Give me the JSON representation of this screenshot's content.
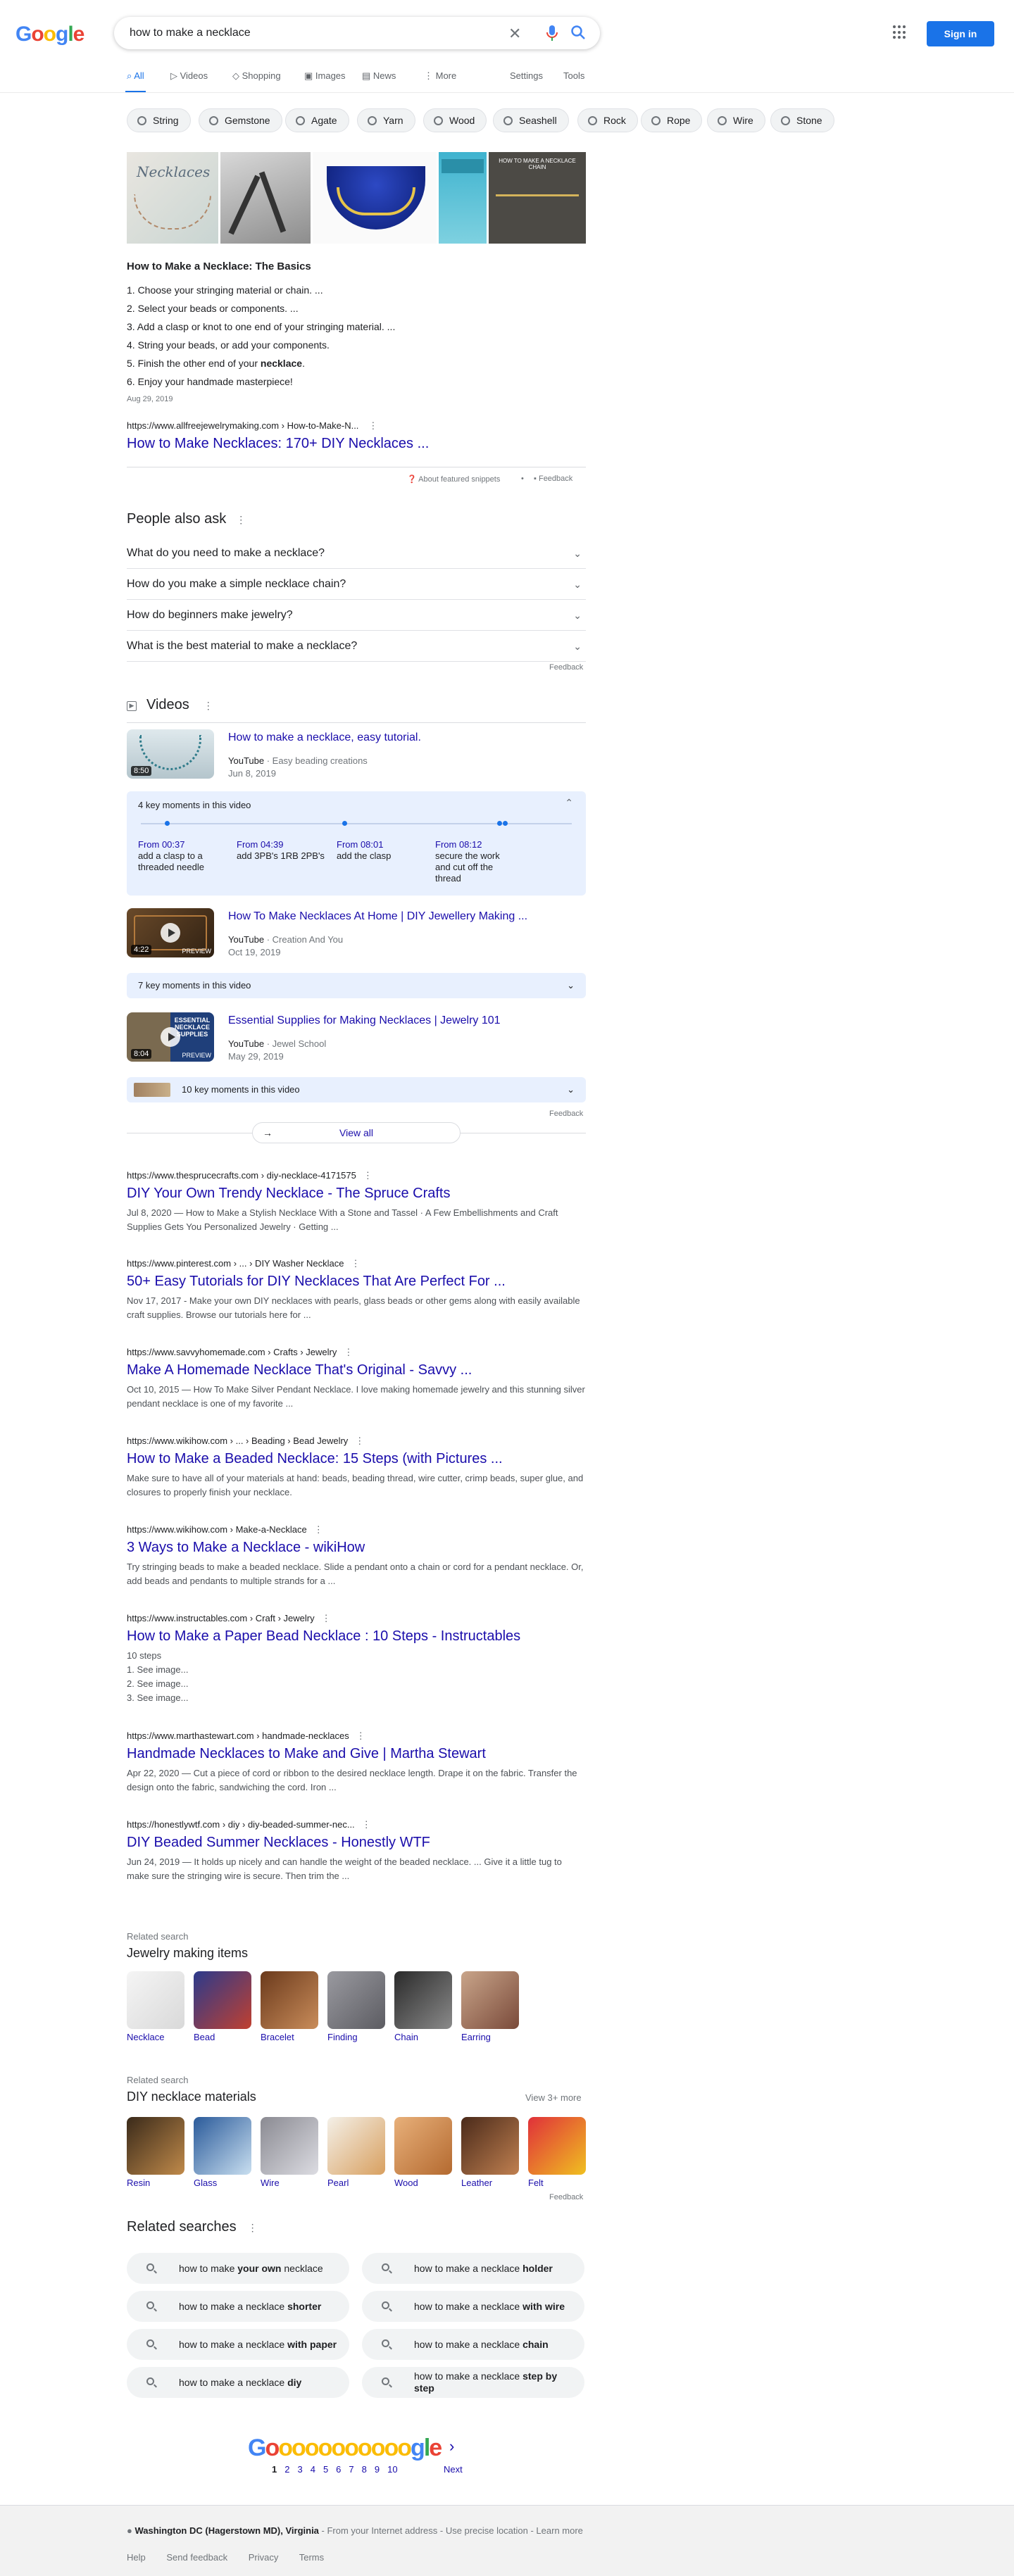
{
  "header": {
    "logo_letters": [
      "G",
      "o",
      "o",
      "g",
      "l",
      "e"
    ],
    "logo_colors": [
      "#4285f4",
      "#ea4335",
      "#fbbc05",
      "#4285f4",
      "#34a853",
      "#ea4335"
    ],
    "query": "how to make a necklace",
    "signin_label": "Sign in"
  },
  "tabs": [
    {
      "label": "All",
      "active": true
    },
    {
      "label": "Videos"
    },
    {
      "label": "Shopping"
    },
    {
      "label": "Images"
    },
    {
      "label": "News"
    },
    {
      "label": "More"
    },
    {
      "label": "Settings"
    },
    {
      "label": "Tools"
    }
  ],
  "chips": [
    "String",
    "Gemstone",
    "Agate",
    "Yarn",
    "Wood",
    "Seashell",
    "Rock",
    "Rope",
    "Wire",
    "Stone"
  ],
  "featured": {
    "image_overlay": "Necklaces",
    "image_caption": "HOW TO MAKE A NECKLACE CHAIN",
    "title": "How to Make a Necklace: The Basics",
    "steps": [
      [
        "Choose your stringing material or chain. ...",
        ""
      ],
      [
        "Select your beads or components. ...",
        ""
      ],
      [
        "Add a clasp or knot to one end of your stringing material. ...",
        ""
      ],
      [
        "String your beads, or add your components.",
        ""
      ],
      [
        "Finish the other end of your ",
        "necklace",
        "."
      ],
      [
        "Enjoy your handmade masterpiece!",
        ""
      ]
    ],
    "date": "Aug 29, 2019",
    "url": "https://www.allfreejewelrymaking.com › How-to-Make-N...",
    "link": "How to Make Necklaces: 170+ DIY Necklaces ...",
    "about": "About featured snippets",
    "feedback": "Feedback"
  },
  "paa": {
    "title": "People also ask",
    "questions": [
      "What do you need to make a necklace?",
      "How do you make a simple necklace chain?",
      "How do beginners make jewelry?",
      "What is the best material to make a necklace?"
    ],
    "feedback": "Feedback"
  },
  "videos": {
    "title": "Videos",
    "items": [
      {
        "title": "How to make a necklace, easy tutorial.",
        "source": "YouTube",
        "channel": "Easy beading creations",
        "date": "Jun 8, 2019",
        "duration": "8:50",
        "key_label": "4 key moments in this video",
        "moments": [
          {
            "time": "From 00:37",
            "text": "add a clasp to a threaded needle"
          },
          {
            "time": "From 04:39",
            "text": "add 3PB's 1RB 2PB's"
          },
          {
            "time": "From 08:01",
            "text": "add the clasp"
          },
          {
            "time": "From 08:12",
            "text": "secure the work and cut off the thread"
          }
        ]
      },
      {
        "title": "How To Make Necklaces At Home | DIY Jewellery Making ...",
        "source": "YouTube",
        "channel": "Creation And You",
        "date": "Oct 19, 2019",
        "duration": "4:22",
        "thumb_text": "PREVIEW",
        "key_label": "7 key moments in this video"
      },
      {
        "title": "Essential Supplies for Making Necklaces | Jewelry 101",
        "source": "YouTube",
        "channel": "Jewel School",
        "date": "May 29, 2019",
        "duration": "8:04",
        "thumb_text": "ESSENTIAL NECKLACE SUPPLIES",
        "thumb_sub": "PREVIEW",
        "key_label": "10 key moments in this video"
      }
    ],
    "feedback": "Feedback",
    "view_all": "View all"
  },
  "results": [
    {
      "url": "https://www.thesprucecrafts.com › diy-necklace-4171575",
      "title": "DIY Your Own Trendy Necklace - The Spruce Crafts",
      "snippet": "Jul 8, 2020 — How to Make a Stylish Necklace With a Stone and Tassel · A Few Embellishments and Craft Supplies Gets You Personalized Jewelry · Getting ..."
    },
    {
      "url": "https://www.pinterest.com › ... › DIY Washer Necklace",
      "title": "50+ Easy Tutorials for DIY Necklaces That Are Perfect For ...",
      "snippet": "Nov 17, 2017 - Make your own DIY necklaces with pearls, glass beads or other gems along with easily available craft supplies. Browse our tutorials here for ..."
    },
    {
      "url": "https://www.savvyhomemade.com › Crafts › Jewelry",
      "title": "Make A Homemade Necklace That's Original - Savvy ...",
      "snippet": "Oct 10, 2015 — How To Make Silver Pendant Necklace. I love making homemade jewelry and this stunning silver pendant necklace is one of my favorite ..."
    },
    {
      "url": "https://www.wikihow.com › ... › Beading › Bead Jewelry",
      "title": "How to Make a Beaded Necklace: 15 Steps (with Pictures ...",
      "snippet": "Make sure to have all of your materials at hand: beads, beading thread, wire cutter, crimp beads, super glue, and closures to properly finish your necklace."
    },
    {
      "url": "https://www.wikihow.com › Make-a-Necklace",
      "title": "3 Ways to Make a Necklace - wikiHow",
      "snippet": "Try stringing beads to make a beaded necklace. Slide a pendant onto a chain or cord for a pendant necklace. Or, add beads and pendants to multiple strands for a ..."
    },
    {
      "url": "https://www.instructables.com › Craft › Jewelry",
      "title": "How to Make a Paper Bead Necklace : 10 Steps - Instructables",
      "snippet": "10 steps",
      "list": [
        "1.  See image...",
        "2.  See image...",
        "3.  See image..."
      ]
    },
    {
      "url": "https://www.marthastewart.com › handmade-necklaces",
      "title": "Handmade Necklaces to Make and Give | Martha Stewart",
      "snippet": "Apr 22, 2020 — Cut a piece of cord or ribbon to the desired necklace length. Drape it on the fabric. Transfer the design onto the fabric, sandwiching the cord. Iron ..."
    },
    {
      "url": "https://honestlywtf.com › diy › diy-beaded-summer-nec...",
      "title": "DIY Beaded Summer Necklaces - Honestly WTF",
      "snippet": "Jun 24, 2019 — It holds up nicely and can handle the weight of the beaded necklace. ... Give it a little tug to make sure the stringing wire is secure. Then trim the ..."
    }
  ],
  "jewelry_items": {
    "label": "Related search",
    "title": "Jewelry making items",
    "items": [
      "Necklace",
      "Bead",
      "Bracelet",
      "Finding",
      "Chain",
      "Earring"
    ]
  },
  "materials": {
    "label": "Related search",
    "title": "DIY necklace materials",
    "view_more": "View 3+ more",
    "items": [
      "Resin",
      "Glass",
      "Wire",
      "Pearl",
      "Wood",
      "Leather",
      "Felt"
    ],
    "feedback": "Feedback"
  },
  "related": {
    "title": "Related searches",
    "items": [
      [
        "how to make ",
        "your own",
        " necklace"
      ],
      [
        "how to make a necklace ",
        "holder",
        ""
      ],
      [
        "how to make a necklace ",
        "shorter",
        ""
      ],
      [
        "how to make a necklace ",
        "with wire",
        ""
      ],
      [
        "how to make a necklace ",
        "with paper",
        ""
      ],
      [
        "how to make a necklace ",
        "chain",
        ""
      ],
      [
        "how to make a necklace ",
        "diy",
        ""
      ],
      [
        "how to make a necklace ",
        "step by step",
        ""
      ]
    ]
  },
  "pagination": {
    "pages": [
      "1",
      "2",
      "3",
      "4",
      "5",
      "6",
      "7",
      "8",
      "9",
      "10"
    ],
    "next": "Next"
  },
  "footer": {
    "location": "Washington DC (Hagerstown MD), Virginia",
    "location_note": " - From your Internet address - Use precise location - Learn more",
    "links": [
      "Help",
      "Send feedback",
      "Privacy",
      "Terms"
    ]
  }
}
